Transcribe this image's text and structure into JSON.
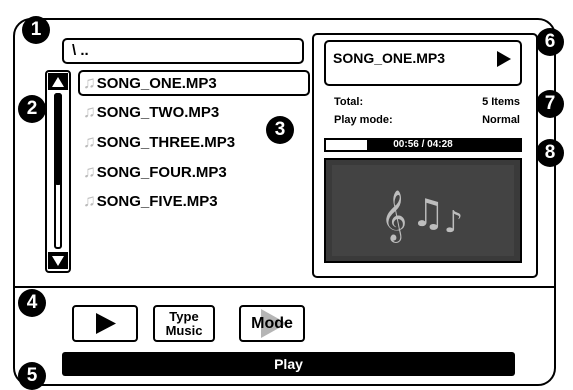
{
  "path": "\\ ..",
  "file_list": [
    {
      "name": "SONG_ONE.MP3",
      "selected": true
    },
    {
      "name": "SONG_TWO.MP3"
    },
    {
      "name": "SONG_THREE.MP3"
    },
    {
      "name": "SONG_FOUR.MP3"
    },
    {
      "name": "SONG_FIVE.MP3"
    }
  ],
  "scrollbar": {
    "up_icon": "arrow-up-icon",
    "down_icon": "arrow-down-icon"
  },
  "now_playing": {
    "title": "SONG_ONE.MP3",
    "play_icon": "play-icon"
  },
  "info": {
    "total_label": "Total:",
    "total_value": "5 Items",
    "playmode_label": "Play mode:",
    "playmode_value": "Normal"
  },
  "progress": {
    "text": "00:56 / 04:28",
    "fraction": 0.21
  },
  "album_art_icon": "music-notes-icon",
  "controls": {
    "play_icon": "play-icon",
    "type_line1": "Type",
    "type_line2": "Music",
    "mode_label": "Mode"
  },
  "status_bar": "Play",
  "callouts": [
    "1",
    "2",
    "3",
    "4",
    "5",
    "6",
    "7",
    "8"
  ],
  "colors": {
    "background": "#ffffff",
    "foreground": "#000000",
    "album_art": "#333333"
  }
}
